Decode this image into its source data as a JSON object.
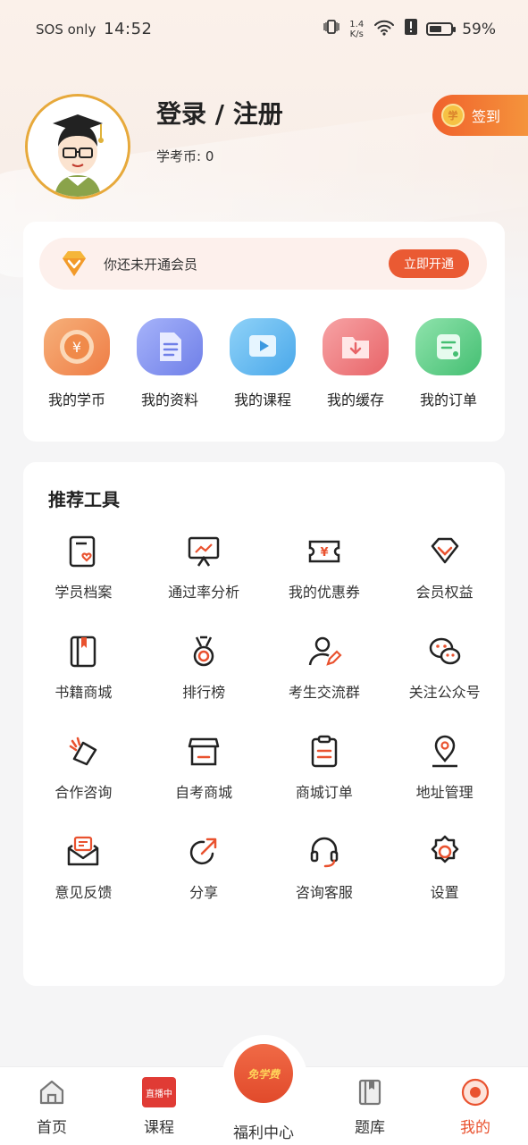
{
  "status_bar": {
    "carrier": "SOS only",
    "time": "14:52",
    "net_speed_value": "1.4",
    "net_speed_unit": "K/s",
    "battery_text": "59%",
    "battery_level": 0.59
  },
  "profile": {
    "login_label": "登录 / 注册",
    "coins_label": "学考币: 0",
    "signin_label": "签到",
    "signin_coin_char": "学"
  },
  "vip": {
    "text": "你还未开通会员",
    "button": "立即开通"
  },
  "quick_actions": [
    {
      "label": "我的学币",
      "icon": "coin-icon",
      "color": "#f39a5f"
    },
    {
      "label": "我的资料",
      "icon": "document-icon",
      "color": "#7f8ff0"
    },
    {
      "label": "我的课程",
      "icon": "play-icon",
      "color": "#5fb8ef"
    },
    {
      "label": "我的缓存",
      "icon": "download-folder-icon",
      "color": "#ef7d80"
    },
    {
      "label": "我的订单",
      "icon": "order-icon",
      "color": "#5fcf8a"
    }
  ],
  "tools": {
    "title": "推荐工具",
    "items": [
      {
        "label": "学员档案",
        "icon": "profile-card-icon"
      },
      {
        "label": "通过率分析",
        "icon": "chart-board-icon"
      },
      {
        "label": "我的优惠券",
        "icon": "coupon-icon"
      },
      {
        "label": "会员权益",
        "icon": "diamond-icon"
      },
      {
        "label": "书籍商城",
        "icon": "book-icon"
      },
      {
        "label": "排行榜",
        "icon": "medal-icon"
      },
      {
        "label": "考生交流群",
        "icon": "user-edit-icon"
      },
      {
        "label": "关注公众号",
        "icon": "wechat-icon"
      },
      {
        "label": "合作咨询",
        "icon": "handshake-icon"
      },
      {
        "label": "自考商城",
        "icon": "store-icon"
      },
      {
        "label": "商城订单",
        "icon": "clipboard-icon"
      },
      {
        "label": "地址管理",
        "icon": "location-icon"
      },
      {
        "label": "意见反馈",
        "icon": "feedback-icon"
      },
      {
        "label": "分享",
        "icon": "share-icon"
      },
      {
        "label": "咨询客服",
        "icon": "headset-icon"
      },
      {
        "label": "设置",
        "icon": "gear-icon"
      }
    ]
  },
  "nav": {
    "home": "首页",
    "courses": "课程",
    "live_badge": "直播中",
    "center": "福利中心",
    "center_badge": "免学费",
    "questions": "题库",
    "mine": "我的"
  },
  "colors": {
    "accent": "#e9522f",
    "vip_button": "#ea5a33",
    "avatar_border": "#e7a93b"
  }
}
